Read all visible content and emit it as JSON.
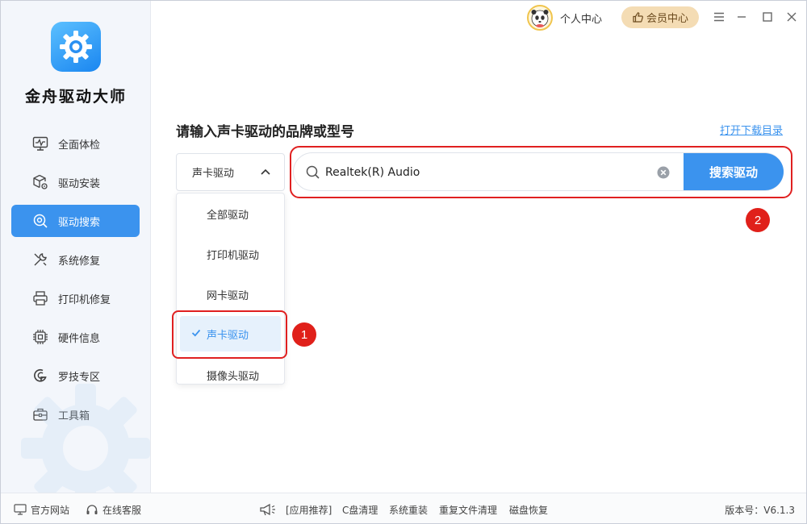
{
  "app": {
    "name": "金舟驱动大师"
  },
  "sidebar": {
    "items": [
      {
        "label": "全面体检",
        "icon": "monitor-check-icon"
      },
      {
        "label": "驱动安装",
        "icon": "cube-gear-icon"
      },
      {
        "label": "驱动搜索",
        "icon": "search-gear-icon",
        "active": true
      },
      {
        "label": "系统修复",
        "icon": "wrench-screwdriver-icon"
      },
      {
        "label": "打印机修复",
        "icon": "printer-icon"
      },
      {
        "label": "硬件信息",
        "icon": "chip-icon"
      },
      {
        "label": "罗技专区",
        "icon": "logitech-icon"
      },
      {
        "label": "工具箱",
        "icon": "toolbox-icon"
      }
    ]
  },
  "titlebar": {
    "personal_label": "个人中心",
    "member_label": "会员中心"
  },
  "main": {
    "heading": "请输入声卡驱动的品牌或型号",
    "open_dir_link": "打开下载目录",
    "select": {
      "value": "声卡驱动",
      "options": [
        "全部驱动",
        "打印机驱动",
        "网卡驱动",
        "声卡驱动",
        "摄像头驱动"
      ],
      "selected_index": 3
    },
    "search": {
      "value": "Realtek(R) Audio",
      "button_label": "搜索驱动"
    },
    "annotations": [
      "1",
      "2"
    ]
  },
  "statusbar": {
    "official_site": "官方网站",
    "online_service": "在线客服",
    "app_recommend": "[应用推荐]",
    "links": [
      "C盘清理",
      "系统重装",
      "重复文件清理",
      "磁盘恢复"
    ],
    "version": "版本号：V6.1.3"
  },
  "colors": {
    "accent": "#3b93ee",
    "annotation": "#e0201a",
    "member": "#f4dcb4"
  }
}
